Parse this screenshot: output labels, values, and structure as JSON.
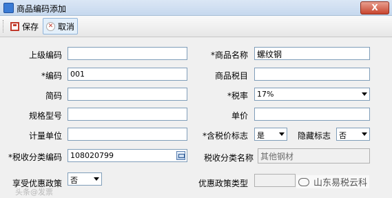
{
  "window": {
    "title": "商品编码添加",
    "close_label": "X"
  },
  "toolbar": {
    "save_label": "保存",
    "cancel_label": "取消"
  },
  "form": {
    "parent_code": {
      "label": "上级编码",
      "value": ""
    },
    "product_name": {
      "label": "*商品名称",
      "value": "螺纹钢"
    },
    "code": {
      "label": "*编码",
      "value": "001"
    },
    "product_tax_item": {
      "label": "商品税目",
      "value": ""
    },
    "short_code": {
      "label": "简码",
      "value": ""
    },
    "tax_rate": {
      "label": "*税率",
      "value": "17%"
    },
    "spec_model": {
      "label": "规格型号",
      "value": ""
    },
    "unit_price": {
      "label": "单价",
      "value": ""
    },
    "unit": {
      "label": "计量单位",
      "value": ""
    },
    "tax_included_flag": {
      "label": "*含税价标志",
      "value": "是"
    },
    "hidden_flag": {
      "label": "隐藏标志",
      "value": "否"
    },
    "tax_class_code": {
      "label": "*税收分类编码",
      "value": "108020799"
    },
    "tax_class_name": {
      "label": "税收分类名称",
      "value": "其他钢材"
    },
    "preferential_policy": {
      "label": "享受优惠政策",
      "value": "否"
    },
    "preferential_policy_type": {
      "label": "优惠政策类型",
      "value": ""
    }
  },
  "watermarks": {
    "left": "头条@发票",
    "right": "山东易税云科"
  }
}
